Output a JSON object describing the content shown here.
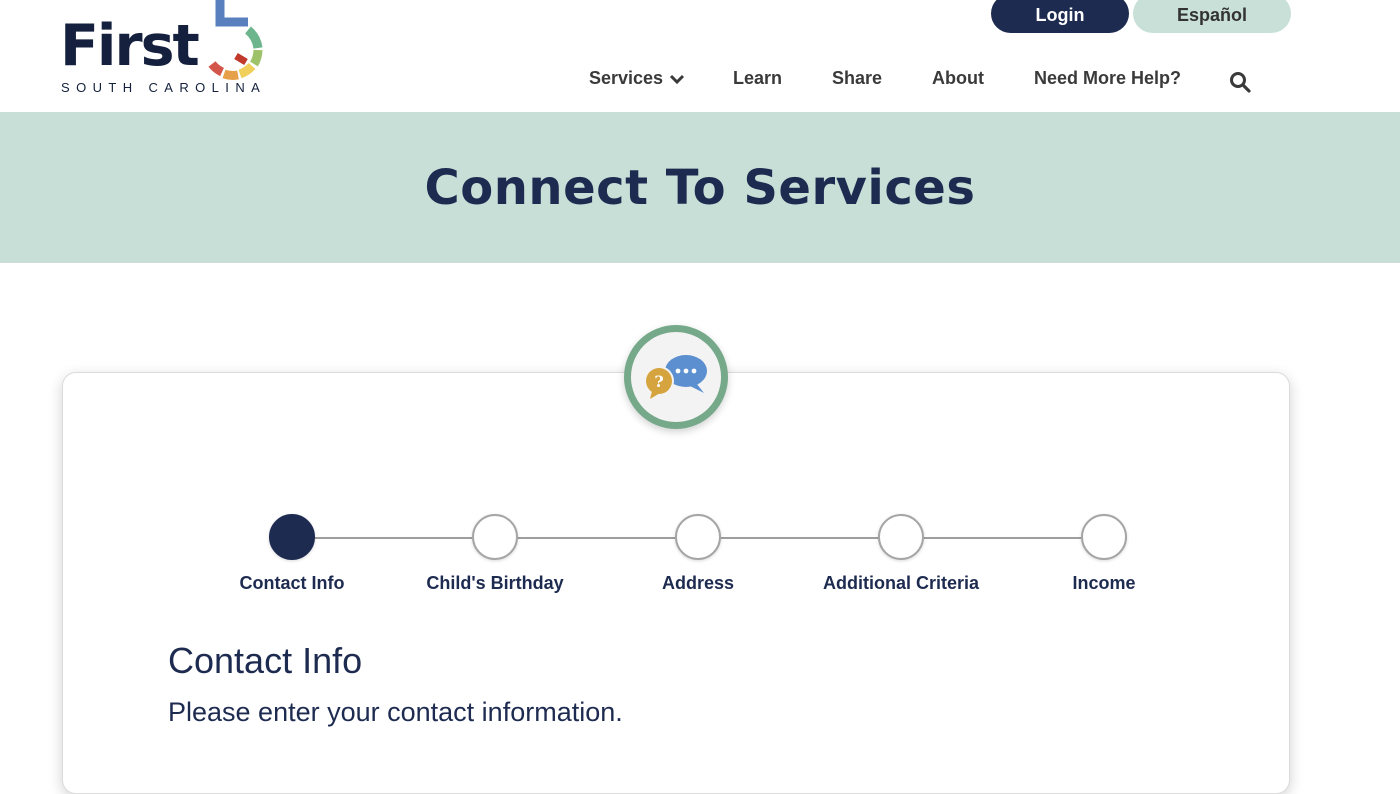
{
  "logo": {
    "word": "First",
    "subtitle": "SOUTH CAROLINA",
    "colors": [
      "#d4564a",
      "#e6a04a",
      "#f0cf5a",
      "#9ec26a",
      "#6db58c",
      "#5a7fbf"
    ]
  },
  "header": {
    "login_label": "Login",
    "espanol_label": "Español"
  },
  "nav": {
    "items": [
      {
        "label": "Services",
        "has_dropdown": true,
        "icon": "chevron-down-icon"
      },
      {
        "label": "Learn"
      },
      {
        "label": "Share"
      },
      {
        "label": "About"
      },
      {
        "label": "Need More Help?"
      }
    ],
    "search_icon": "search-icon"
  },
  "banner": {
    "title": "Connect To Services"
  },
  "badge": {
    "icon": "chat-bubbles-icon",
    "question_mark": "?"
  },
  "stepper": {
    "steps": [
      {
        "label": "Contact Info",
        "active": true
      },
      {
        "label": "Child's Birthday",
        "active": false
      },
      {
        "label": "Address",
        "active": false
      },
      {
        "label": "Additional Criteria",
        "active": false
      },
      {
        "label": "Income",
        "active": false
      }
    ]
  },
  "form": {
    "section_title": "Contact Info",
    "section_description": "Please enter your contact information."
  },
  "colors": {
    "navy": "#1e2b50",
    "mint": "#c8dfd7",
    "badge_ring": "#76a98a"
  }
}
